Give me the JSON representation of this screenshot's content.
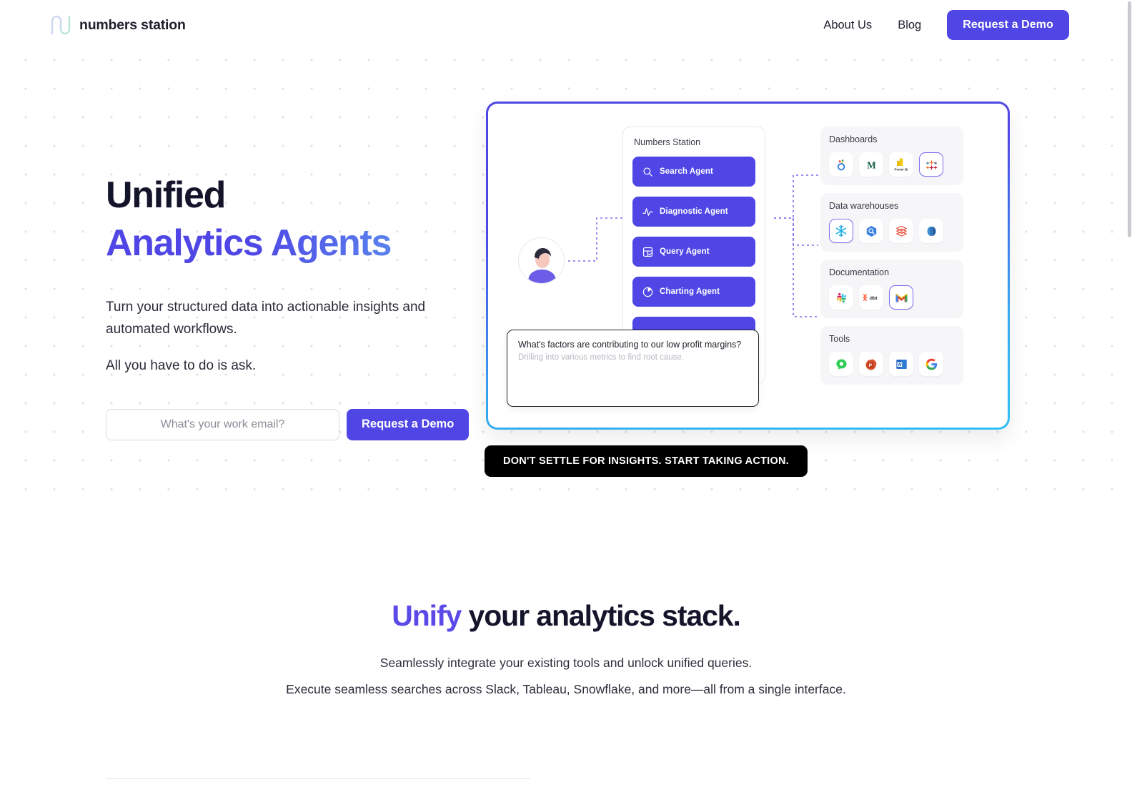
{
  "header": {
    "brand": "numbers station",
    "logo_icon": "numbers-station-mark",
    "nav": [
      {
        "label": "About Us"
      },
      {
        "label": "Blog"
      }
    ],
    "cta": "Request a Demo"
  },
  "hero": {
    "title_line1": "Unified",
    "title_line2": "Analytics Agents",
    "subtitle": "Turn your structured data into actionable insights and automated workflows.",
    "subtitle2": "All you have to do is ask.",
    "email_placeholder": "What's your work email?",
    "email_value": "",
    "cta": "Request a Demo",
    "accent_purple": "#4f46e5",
    "accent_blue": "#6aa3f5"
  },
  "diagram": {
    "agent_panel_title": "Numbers Station",
    "agents": [
      {
        "label": "Search Agent",
        "icon": "search-icon"
      },
      {
        "label": "Diagnostic Agent",
        "icon": "pulse-icon"
      },
      {
        "label": "Query Agent",
        "icon": "grid-check-icon"
      },
      {
        "label": "Charting Agent",
        "icon": "pie-chart-icon"
      },
      {
        "label": "",
        "icon": "agent-icon"
      }
    ],
    "query": {
      "question": "What's factors are contributing to our low profit margins?",
      "status": "Drilling into various metrics to find root cause."
    },
    "groups": [
      {
        "title": "Dashboards",
        "icons": [
          {
            "name": "looker-icon",
            "highlighted": false
          },
          {
            "name": "metabase-icon",
            "highlighted": false
          },
          {
            "name": "power-bi-icon",
            "highlighted": false
          },
          {
            "name": "tableau-icon",
            "highlighted": true
          }
        ]
      },
      {
        "title": "Data warehouses",
        "icons": [
          {
            "name": "snowflake-icon",
            "highlighted": true
          },
          {
            "name": "bigquery-icon",
            "highlighted": false
          },
          {
            "name": "databricks-icon",
            "highlighted": false
          },
          {
            "name": "redshift-icon",
            "highlighted": false
          }
        ]
      },
      {
        "title": "Documentation",
        "icons": [
          {
            "name": "slack-icon",
            "highlighted": false
          },
          {
            "name": "dbt-icon",
            "highlighted": false
          },
          {
            "name": "gmail-icon",
            "highlighted": true
          }
        ]
      },
      {
        "title": "Tools",
        "icons": [
          {
            "name": "wecom-icon",
            "highlighted": false
          },
          {
            "name": "powerpoint-icon",
            "highlighted": false
          },
          {
            "name": "word-icon",
            "highlighted": false
          },
          {
            "name": "google-icon",
            "highlighted": false
          }
        ]
      }
    ],
    "banner": "DON'T SETTLE FOR INSIGHTS. START TAKING ACTION.",
    "border_gradient_from": "#4f46e5",
    "border_gradient_to": "#2ec0f7"
  },
  "unify": {
    "heading_accent": "Unify",
    "heading_rest": " your analytics stack.",
    "para1": "Seamlessly integrate your existing tools and unlock unified queries.",
    "para2": "Execute seamless searches across Slack, Tableau, Snowflake, and more—all from a single interface."
  }
}
